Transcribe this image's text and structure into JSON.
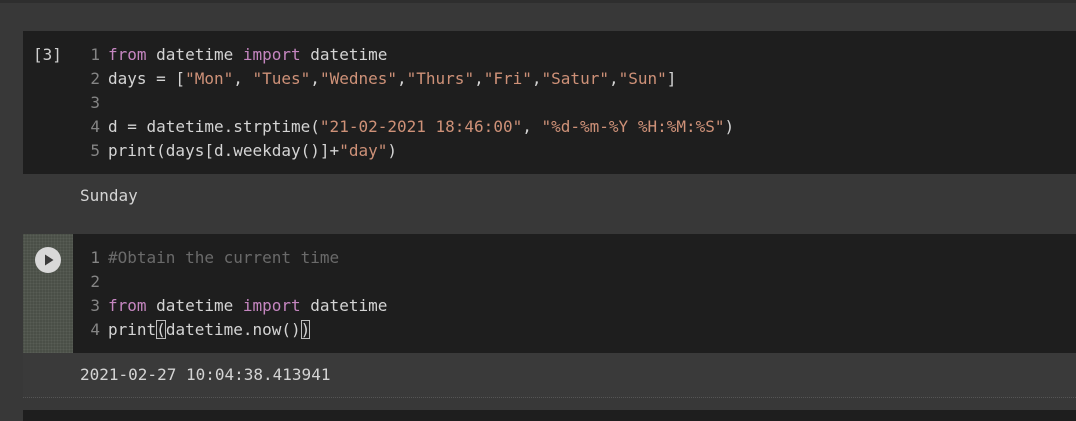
{
  "cell1": {
    "execution_count": "[3]",
    "lines": [
      {
        "num": "1",
        "parts": [
          {
            "t": "from",
            "c": "kw"
          },
          {
            "t": " datetime ",
            "c": ""
          },
          {
            "t": "import",
            "c": "kw"
          },
          {
            "t": " datetime",
            "c": ""
          }
        ]
      },
      {
        "num": "2",
        "parts": [
          {
            "t": "days = [",
            "c": ""
          },
          {
            "t": "\"Mon\"",
            "c": "str"
          },
          {
            "t": ", ",
            "c": ""
          },
          {
            "t": "\"Tues\"",
            "c": "str"
          },
          {
            "t": ",",
            "c": ""
          },
          {
            "t": "\"Wednes\"",
            "c": "str"
          },
          {
            "t": ",",
            "c": ""
          },
          {
            "t": "\"Thurs\"",
            "c": "str"
          },
          {
            "t": ",",
            "c": ""
          },
          {
            "t": "\"Fri\"",
            "c": "str"
          },
          {
            "t": ",",
            "c": ""
          },
          {
            "t": "\"Satur\"",
            "c": "str"
          },
          {
            "t": ",",
            "c": ""
          },
          {
            "t": "\"Sun\"",
            "c": "str"
          },
          {
            "t": "]",
            "c": ""
          }
        ]
      },
      {
        "num": "3",
        "parts": []
      },
      {
        "num": "4",
        "parts": [
          {
            "t": "d = datetime.strptime(",
            "c": ""
          },
          {
            "t": "\"21-02-2021 18:46:00\"",
            "c": "str"
          },
          {
            "t": ", ",
            "c": ""
          },
          {
            "t": "\"%d-%m-%Y %H:%M:%S\"",
            "c": "str"
          },
          {
            "t": ")",
            "c": ""
          }
        ]
      },
      {
        "num": "5",
        "parts": [
          {
            "t": "print(days[d.weekday()]+",
            "c": ""
          },
          {
            "t": "\"day\"",
            "c": "str"
          },
          {
            "t": ")",
            "c": ""
          }
        ]
      }
    ],
    "output": "Sunday"
  },
  "cell2": {
    "run_icon": "play-circle-icon",
    "lines": [
      {
        "num": "1",
        "parts": [
          {
            "t": "#Obtain the current time",
            "c": "cmt"
          }
        ]
      },
      {
        "num": "2",
        "parts": []
      },
      {
        "num": "3",
        "parts": [
          {
            "t": "from",
            "c": "kw"
          },
          {
            "t": " datetime ",
            "c": ""
          },
          {
            "t": "import",
            "c": "kw"
          },
          {
            "t": " datetime",
            "c": ""
          }
        ]
      },
      {
        "num": "4",
        "parts": [
          {
            "t": "print",
            "c": ""
          },
          {
            "t": "(",
            "c": "brk"
          },
          {
            "t": "datetime.now()",
            "c": ""
          },
          {
            "t": ")",
            "c": "brk"
          }
        ]
      }
    ],
    "output": "2021-02-27 10:04:38.413941"
  },
  "colors": {
    "keyword": "#c586c0",
    "string": "#ce9178",
    "comment": "#6a6a6a",
    "text": "#d4d4d4",
    "cell_bg": "#1e1e1e",
    "page_bg": "#383838"
  }
}
